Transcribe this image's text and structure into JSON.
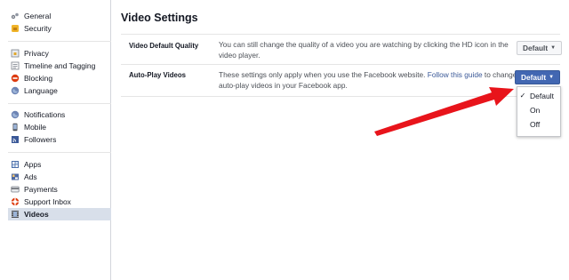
{
  "sidebar": {
    "groups": [
      {
        "items": [
          {
            "label": "General",
            "icon": "gear-icon"
          },
          {
            "label": "Security",
            "icon": "badge-icon"
          }
        ]
      },
      {
        "items": [
          {
            "label": "Privacy",
            "icon": "lock-icon"
          },
          {
            "label": "Timeline and Tagging",
            "icon": "timeline-icon"
          },
          {
            "label": "Blocking",
            "icon": "block-icon"
          },
          {
            "label": "Language",
            "icon": "globe-icon"
          }
        ]
      },
      {
        "items": [
          {
            "label": "Notifications",
            "icon": "globe-icon"
          },
          {
            "label": "Mobile",
            "icon": "mobile-icon"
          },
          {
            "label": "Followers",
            "icon": "rss-icon"
          }
        ]
      },
      {
        "items": [
          {
            "label": "Apps",
            "icon": "apps-icon"
          },
          {
            "label": "Ads",
            "icon": "ads-icon"
          },
          {
            "label": "Payments",
            "icon": "payments-icon"
          },
          {
            "label": "Support Inbox",
            "icon": "lifebuoy-icon"
          },
          {
            "label": "Videos",
            "icon": "film-icon",
            "active": true
          }
        ]
      }
    ]
  },
  "main": {
    "title": "Video Settings",
    "rows": [
      {
        "label": "Video Default Quality",
        "description": "You can still change the quality of a video you are watching by clicking the HD icon in the video player.",
        "button": "Default"
      },
      {
        "label": "Auto-Play Videos",
        "description_before": "These settings only apply when you use the Facebook website. ",
        "link": "Follow this guide",
        "description_after": " to change auto-play videos in your Facebook app.",
        "button": "Default"
      }
    ],
    "menu": {
      "items": [
        {
          "label": "Default",
          "checked": true,
          "check": "✓"
        },
        {
          "label": "On",
          "checked": false,
          "check": ""
        },
        {
          "label": "Off",
          "checked": false,
          "check": ""
        }
      ]
    }
  },
  "colors": {
    "accent": "#4267b2",
    "arrow": "#e8141b",
    "active_bg": "#d8dfea",
    "link": "#3b5998"
  }
}
